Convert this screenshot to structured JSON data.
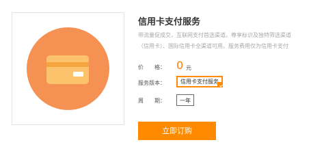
{
  "colors": {
    "accent": "#ff8a00",
    "circle": "#f59253",
    "card": "#fcc36c",
    "card_stripe": "#f5a540",
    "price": "#ff7a00"
  },
  "product": {
    "image_icon": "credit-card-icon",
    "title": "信用卡支付服务",
    "description": [
      "带流量促成交，互联网支付首选渠道。尊享标识及独特筛选渠道",
      "（信用卡）、国际信用卡全渠道可用。服务费用仅为信用卡支付"
    ]
  },
  "price": {
    "label": "价　　格：",
    "value": "0",
    "unit": "元"
  },
  "version": {
    "label": "服务版本：",
    "options": [
      "信用卡支付服务"
    ],
    "selected": "信用卡支付服务"
  },
  "period": {
    "label": "周　　期：",
    "options": [
      "一年"
    ]
  },
  "buy_button": {
    "label": "立即订购"
  }
}
